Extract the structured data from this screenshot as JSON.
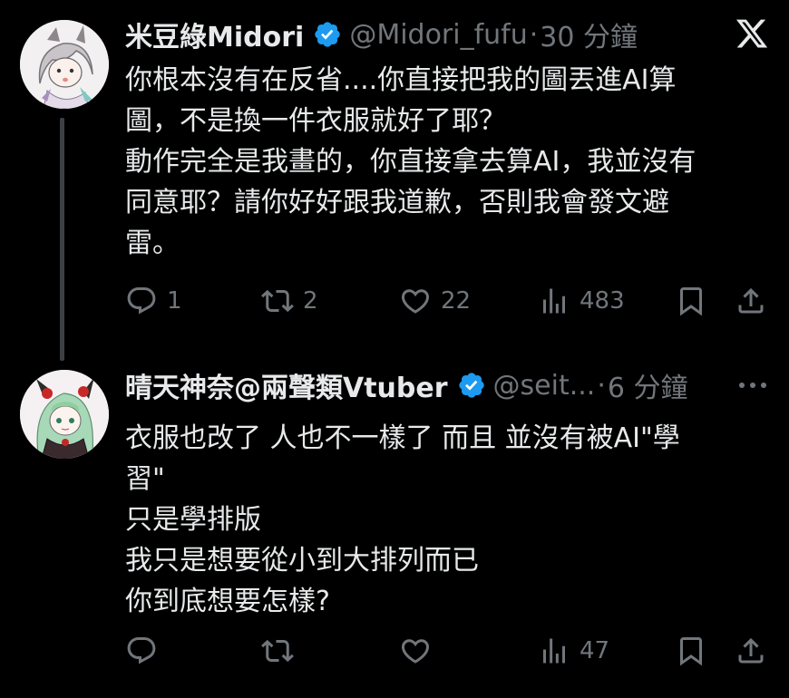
{
  "tweets": [
    {
      "display_name": "米豆綠Midori",
      "handle": "@Midori_fufu",
      "separator": "·",
      "time": "30 分鐘",
      "body": "你根本沒有在反省....你直接把我的圖丟進AI算\n圖，不是換一件衣服就好了耶？\n動作完全是我畫的，你直接拿去算AI，我並沒有\n同意耶？請你好好跟我道歉，否則我會發文避\n雷。",
      "stats": {
        "replies": "1",
        "reposts": "2",
        "likes": "22",
        "views": "483"
      },
      "icons": [
        "verified-badge-icon",
        "x-logo-icon"
      ]
    },
    {
      "display_name": "晴天神奈@兩聲類Vtuber",
      "handle": "@seit...",
      "separator": "·",
      "time": "6 分鐘",
      "body": "衣服也改了 人也不一樣了 而且 並沒有被AI\"學\n習\"\n只是學排版\n我只是想要從小到大排列而已\n你到底想要怎樣?",
      "stats": {
        "replies": "",
        "reposts": "",
        "likes": "",
        "views": "47"
      },
      "icons": [
        "verified-badge-icon",
        "more-icon"
      ]
    }
  ],
  "colors": {
    "background": "#000000",
    "text_primary": "#e7e9ea",
    "text_secondary": "#71767b",
    "verified_blue": "#1d9bf0",
    "thread_line": "#3e4144"
  },
  "action_icons": [
    "reply-icon",
    "repost-icon",
    "like-icon",
    "views-icon",
    "bookmark-icon",
    "share-icon"
  ]
}
